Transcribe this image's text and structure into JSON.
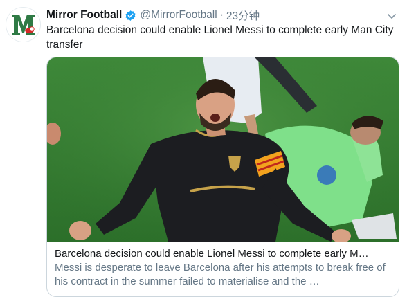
{
  "tweet": {
    "display_name": "Mirror Football",
    "handle": "@MirrorFootball",
    "separator": "·",
    "time": "23分钟",
    "verified": true,
    "avatar_icon": "mirror-m-logo-icon",
    "text": "Barcelona decision could enable Lionel Messi to complete early Man City transfer"
  },
  "card": {
    "image_icon": "football-celebration-photo",
    "title": "Barcelona decision could enable Lionel Messi to complete early M…",
    "description": "Messi is desperate to leave Barcelona after his attempts to break free of his contract in the summer failed to materialise and the …"
  },
  "colors": {
    "accent": "#1da1f2",
    "name_text": "#14171a",
    "secondary_text": "#657786",
    "border": "#ccd6dd",
    "logo_green": "#2f7a45",
    "logo_red": "#d62828"
  }
}
